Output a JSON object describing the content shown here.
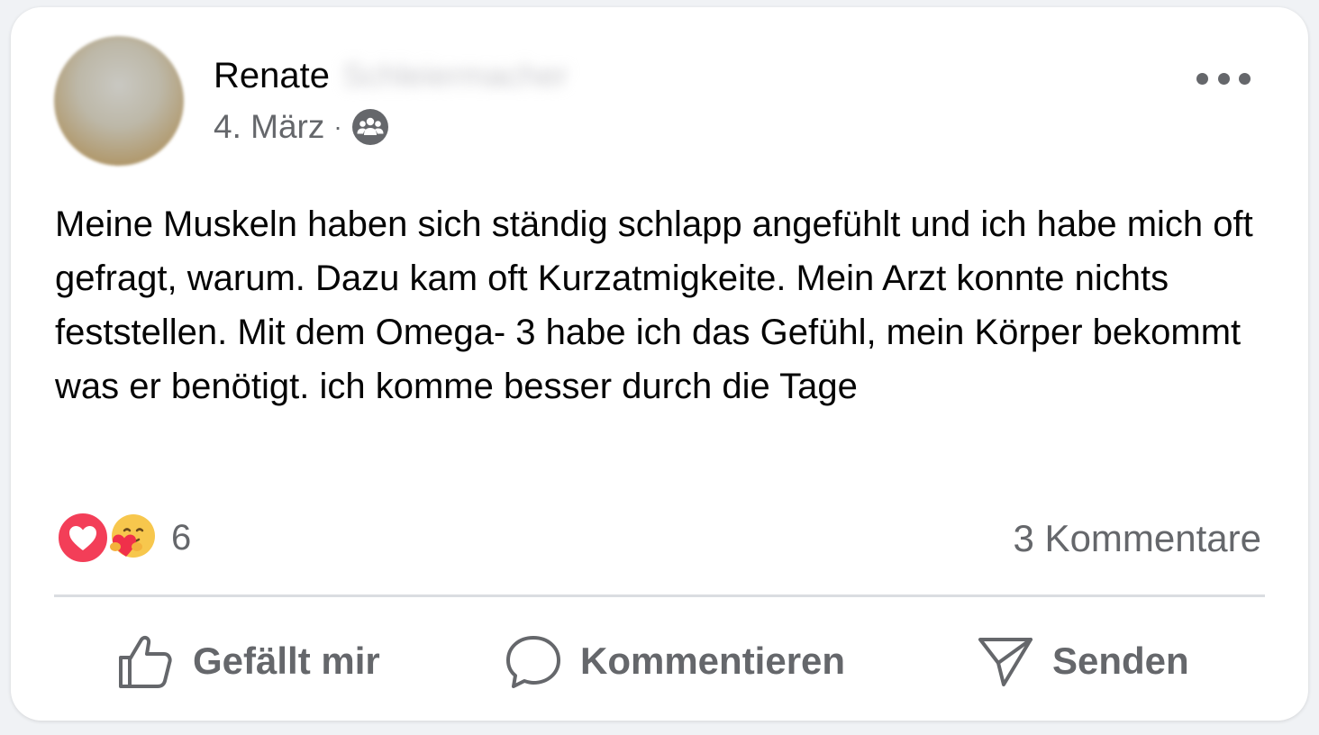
{
  "post": {
    "author_first": "Renate",
    "author_last": "Schleiermacher",
    "date": "4. März",
    "separator": "·",
    "audience_icon": "friends-icon",
    "text": "Meine Muskeln haben sich ständig schlapp angefühlt und ich habe mich oft gefragt, warum. Dazu kam oft Kurzatmigkeite. Mein Arzt konnte nichts feststellen. Mit dem Omega- 3 habe ich das Gefühl, mein Körper bekommt was er benötigt. ich komme besser durch die Tage"
  },
  "reactions": {
    "types": [
      "love",
      "care"
    ],
    "count": "6",
    "comments": "3 Kommentare"
  },
  "actions": {
    "like": "Gefällt mir",
    "comment": "Kommentieren",
    "send": "Senden"
  },
  "colors": {
    "text": "#050505",
    "secondary": "#65676b",
    "love": "#f33e58",
    "divider": "#dadde1"
  }
}
